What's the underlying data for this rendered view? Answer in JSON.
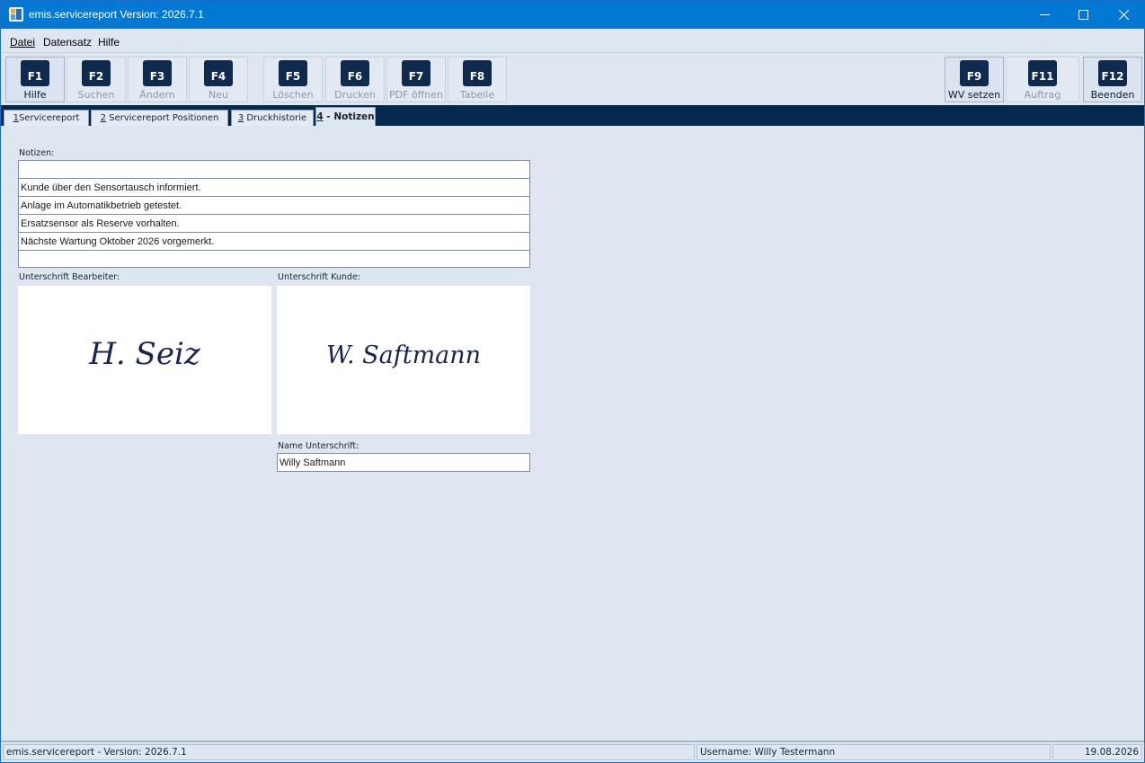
{
  "window": {
    "title": "emis.servicereport Version: 2026.7.1",
    "title_bar_color": "#0078d4"
  },
  "menu": {
    "items": [
      {
        "label": "Datei",
        "underlined": true
      },
      {
        "label": "Datensatz",
        "underlined": false
      },
      {
        "label": "Hilfe",
        "underlined": false
      }
    ]
  },
  "toolbar": {
    "buttons": [
      {
        "key": "F1",
        "label": "Hilfe",
        "enabled": true
      },
      {
        "key": "F2",
        "label": "Suchen",
        "enabled": false
      },
      {
        "key": "F3",
        "label": "Ändern",
        "enabled": false
      },
      {
        "key": "F4",
        "label": "Neu",
        "enabled": false
      },
      {
        "key": "F5",
        "label": "Löschen",
        "enabled": false
      },
      {
        "key": "F6",
        "label": "Drucken",
        "enabled": false
      },
      {
        "key": "F7",
        "label": "PDF öffnen",
        "enabled": false
      },
      {
        "key": "F8",
        "label": "Tabelle",
        "enabled": false
      },
      {
        "key": "F9",
        "label": "WV setzen",
        "enabled": true
      },
      {
        "key": "F11",
        "label": "Auftrag",
        "enabled": false
      },
      {
        "key": "F12",
        "label": "Beenden",
        "enabled": true
      }
    ]
  },
  "tabs": [
    {
      "num": "1",
      "label": "Servicereport",
      "active": false
    },
    {
      "num": "2",
      "label": "Servicereport Positionen",
      "active": false
    },
    {
      "num": "3",
      "label": "Druckhistorie",
      "active": false
    },
    {
      "num": "4",
      "label": " - Notizen",
      "active": true
    }
  ],
  "notes": {
    "label": "Notizen:",
    "lines": [
      "",
      "Kunde über den Sensortausch informiert.",
      "Anlage im Automatikbetrieb getestet.",
      "Ersatzsensor als Reserve vorhalten.",
      "Nächste Wartung Oktober 2026 vorgemerkt.",
      ""
    ]
  },
  "signatures": {
    "technician_label": "Unterschrift Bearbeiter:",
    "technician_signature": "H. Seiz",
    "customer_label": "Unterschrift Kunde:",
    "customer_signature": "W. Saftmann",
    "name_label": "Name Unterschrift:",
    "name_value": "Willy Saftmann"
  },
  "status": {
    "version": "emis.servicereport - Version: 2026.7.1",
    "user": "Username: Willy Testermann",
    "date": "19.08.2026"
  },
  "colors": {
    "accent_dark": "#0f2a4f",
    "tab_strip": "#03294f",
    "background": "#dde6f1"
  }
}
